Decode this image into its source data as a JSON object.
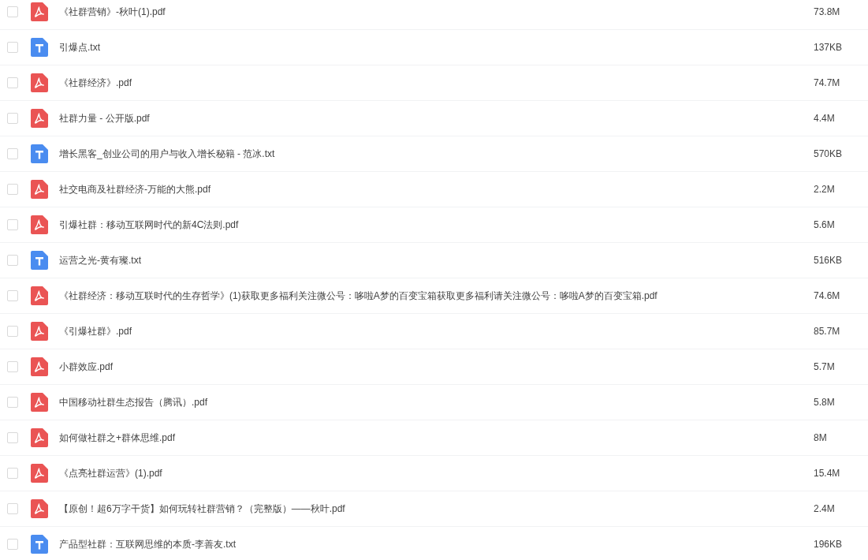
{
  "files": [
    {
      "kind": "pdf",
      "checked": false,
      "name": "《社群营销》-秋叶(1).pdf",
      "size": "73.8M"
    },
    {
      "kind": "txt",
      "checked": false,
      "name": "引爆点.txt",
      "size": "137KB"
    },
    {
      "kind": "pdf",
      "checked": false,
      "name": "《社群经济》.pdf",
      "size": "74.7M"
    },
    {
      "kind": "pdf",
      "checked": false,
      "name": "社群力量 - 公开版.pdf",
      "size": "4.4M"
    },
    {
      "kind": "txt",
      "checked": false,
      "name": "增长黑客_创业公司的用户与收入增长秘籍 - 范冰.txt",
      "size": "570KB"
    },
    {
      "kind": "pdf",
      "checked": false,
      "name": "社交电商及社群经济-万能的大熊.pdf",
      "size": "2.2M"
    },
    {
      "kind": "pdf",
      "checked": false,
      "name": "引爆社群：移动互联网时代的新4C法则.pdf",
      "size": "5.6M"
    },
    {
      "kind": "txt",
      "checked": false,
      "name": "运营之光-黄有璨.txt",
      "size": "516KB"
    },
    {
      "kind": "pdf",
      "checked": false,
      "name": "《社群经济：移动互联时代的生存哲学》(1)获取更多福利关注微公号：哆啦A梦的百变宝箱获取更多福利请关注微公号：哆啦A梦的百变宝箱.pdf",
      "size": "74.6M"
    },
    {
      "kind": "pdf",
      "checked": false,
      "name": "《引爆社群》.pdf",
      "size": "85.7M"
    },
    {
      "kind": "pdf",
      "checked": false,
      "name": "小群效应.pdf",
      "size": "5.7M"
    },
    {
      "kind": "pdf",
      "checked": false,
      "name": "中国移动社群生态报告（腾讯）.pdf",
      "size": "5.8M"
    },
    {
      "kind": "pdf",
      "checked": false,
      "name": "如何做社群之+群体思维.pdf",
      "size": "8M"
    },
    {
      "kind": "pdf",
      "checked": false,
      "name": "《点亮社群运营》(1).pdf",
      "size": "15.4M"
    },
    {
      "kind": "pdf",
      "checked": false,
      "name": "【原创！超6万字干货】如何玩转社群营销？（完整版）——秋叶.pdf",
      "size": "2.4M"
    },
    {
      "kind": "txt",
      "checked": false,
      "name": "产品型社群：互联网思维的本质-李善友.txt",
      "size": "196KB"
    }
  ]
}
